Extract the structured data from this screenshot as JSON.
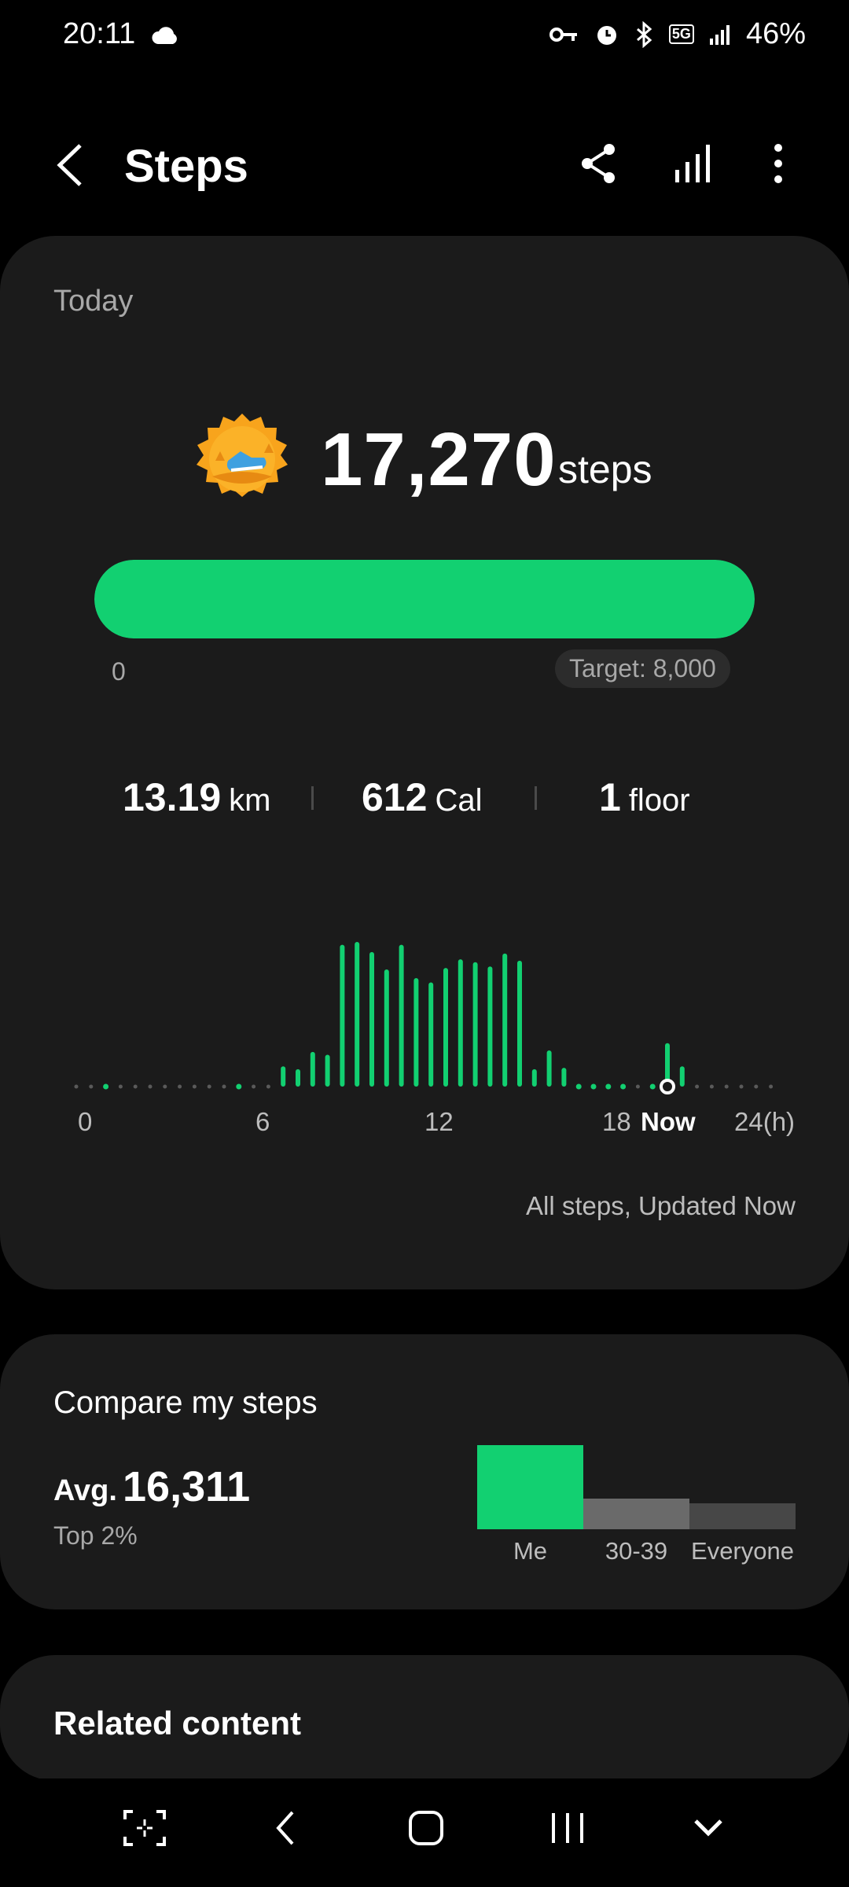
{
  "status_bar": {
    "time": "20:11",
    "battery": "46%",
    "network": "5G",
    "icons": [
      "cloud-icon",
      "key-icon",
      "alarm-icon",
      "bluetooth-icon",
      "5g-icon",
      "signal-icon"
    ]
  },
  "app_bar": {
    "title": "Steps",
    "icons": [
      "back-icon",
      "share-icon",
      "chart-icon",
      "more-icon"
    ]
  },
  "summary": {
    "period": "Today",
    "steps": "17,270",
    "steps_unit": "steps",
    "progress_fraction": 1.0,
    "progress_min": "0",
    "target_label": "Target: 8,000",
    "distance": "13.19",
    "distance_unit": "km",
    "calories": "612",
    "calories_unit": "Cal",
    "floors": "1",
    "floors_unit": "floor",
    "updated": "All steps, Updated Now",
    "accent_color": "#12d071"
  },
  "chart_data": {
    "type": "bar",
    "x_tick_labels": [
      "0",
      "6",
      "12",
      "18",
      "Now",
      "24(h)"
    ],
    "xlim": [
      0,
      24
    ],
    "x_unit": "h",
    "values_relative_to_max": [
      0,
      0,
      0.01,
      0,
      0,
      0,
      0,
      0,
      0,
      0,
      0,
      0.01,
      0,
      0,
      0.14,
      0.12,
      0.24,
      0.22,
      0.98,
      1.0,
      0.93,
      0.81,
      0.98,
      0.75,
      0.72,
      0.82,
      0.88,
      0.86,
      0.83,
      0.92,
      0.87,
      0.12,
      0.25,
      0.13,
      0.02,
      0.01,
      0.01,
      0.01,
      0,
      0.01,
      0.3,
      0.14,
      0,
      0,
      0,
      0,
      0,
      0
    ],
    "current_time_marker": "Now",
    "grid": false
  },
  "compare": {
    "title": "Compare my steps",
    "avg_label": "Avg.",
    "avg_value": "16,311",
    "rank": "Top 2%",
    "bars": [
      {
        "label": "Me",
        "relative": 1.0,
        "color": "#12d071"
      },
      {
        "label": "30-39",
        "relative": 0.36,
        "color": "#6a6a6a"
      },
      {
        "label": "Everyone",
        "relative": 0.31,
        "color": "#474747"
      }
    ]
  },
  "related": {
    "title": "Related content"
  },
  "nav_bar": {
    "icons": [
      "screenshot-icon",
      "back-nav-icon",
      "home-icon",
      "recents-icon",
      "chevron-down-icon"
    ]
  }
}
